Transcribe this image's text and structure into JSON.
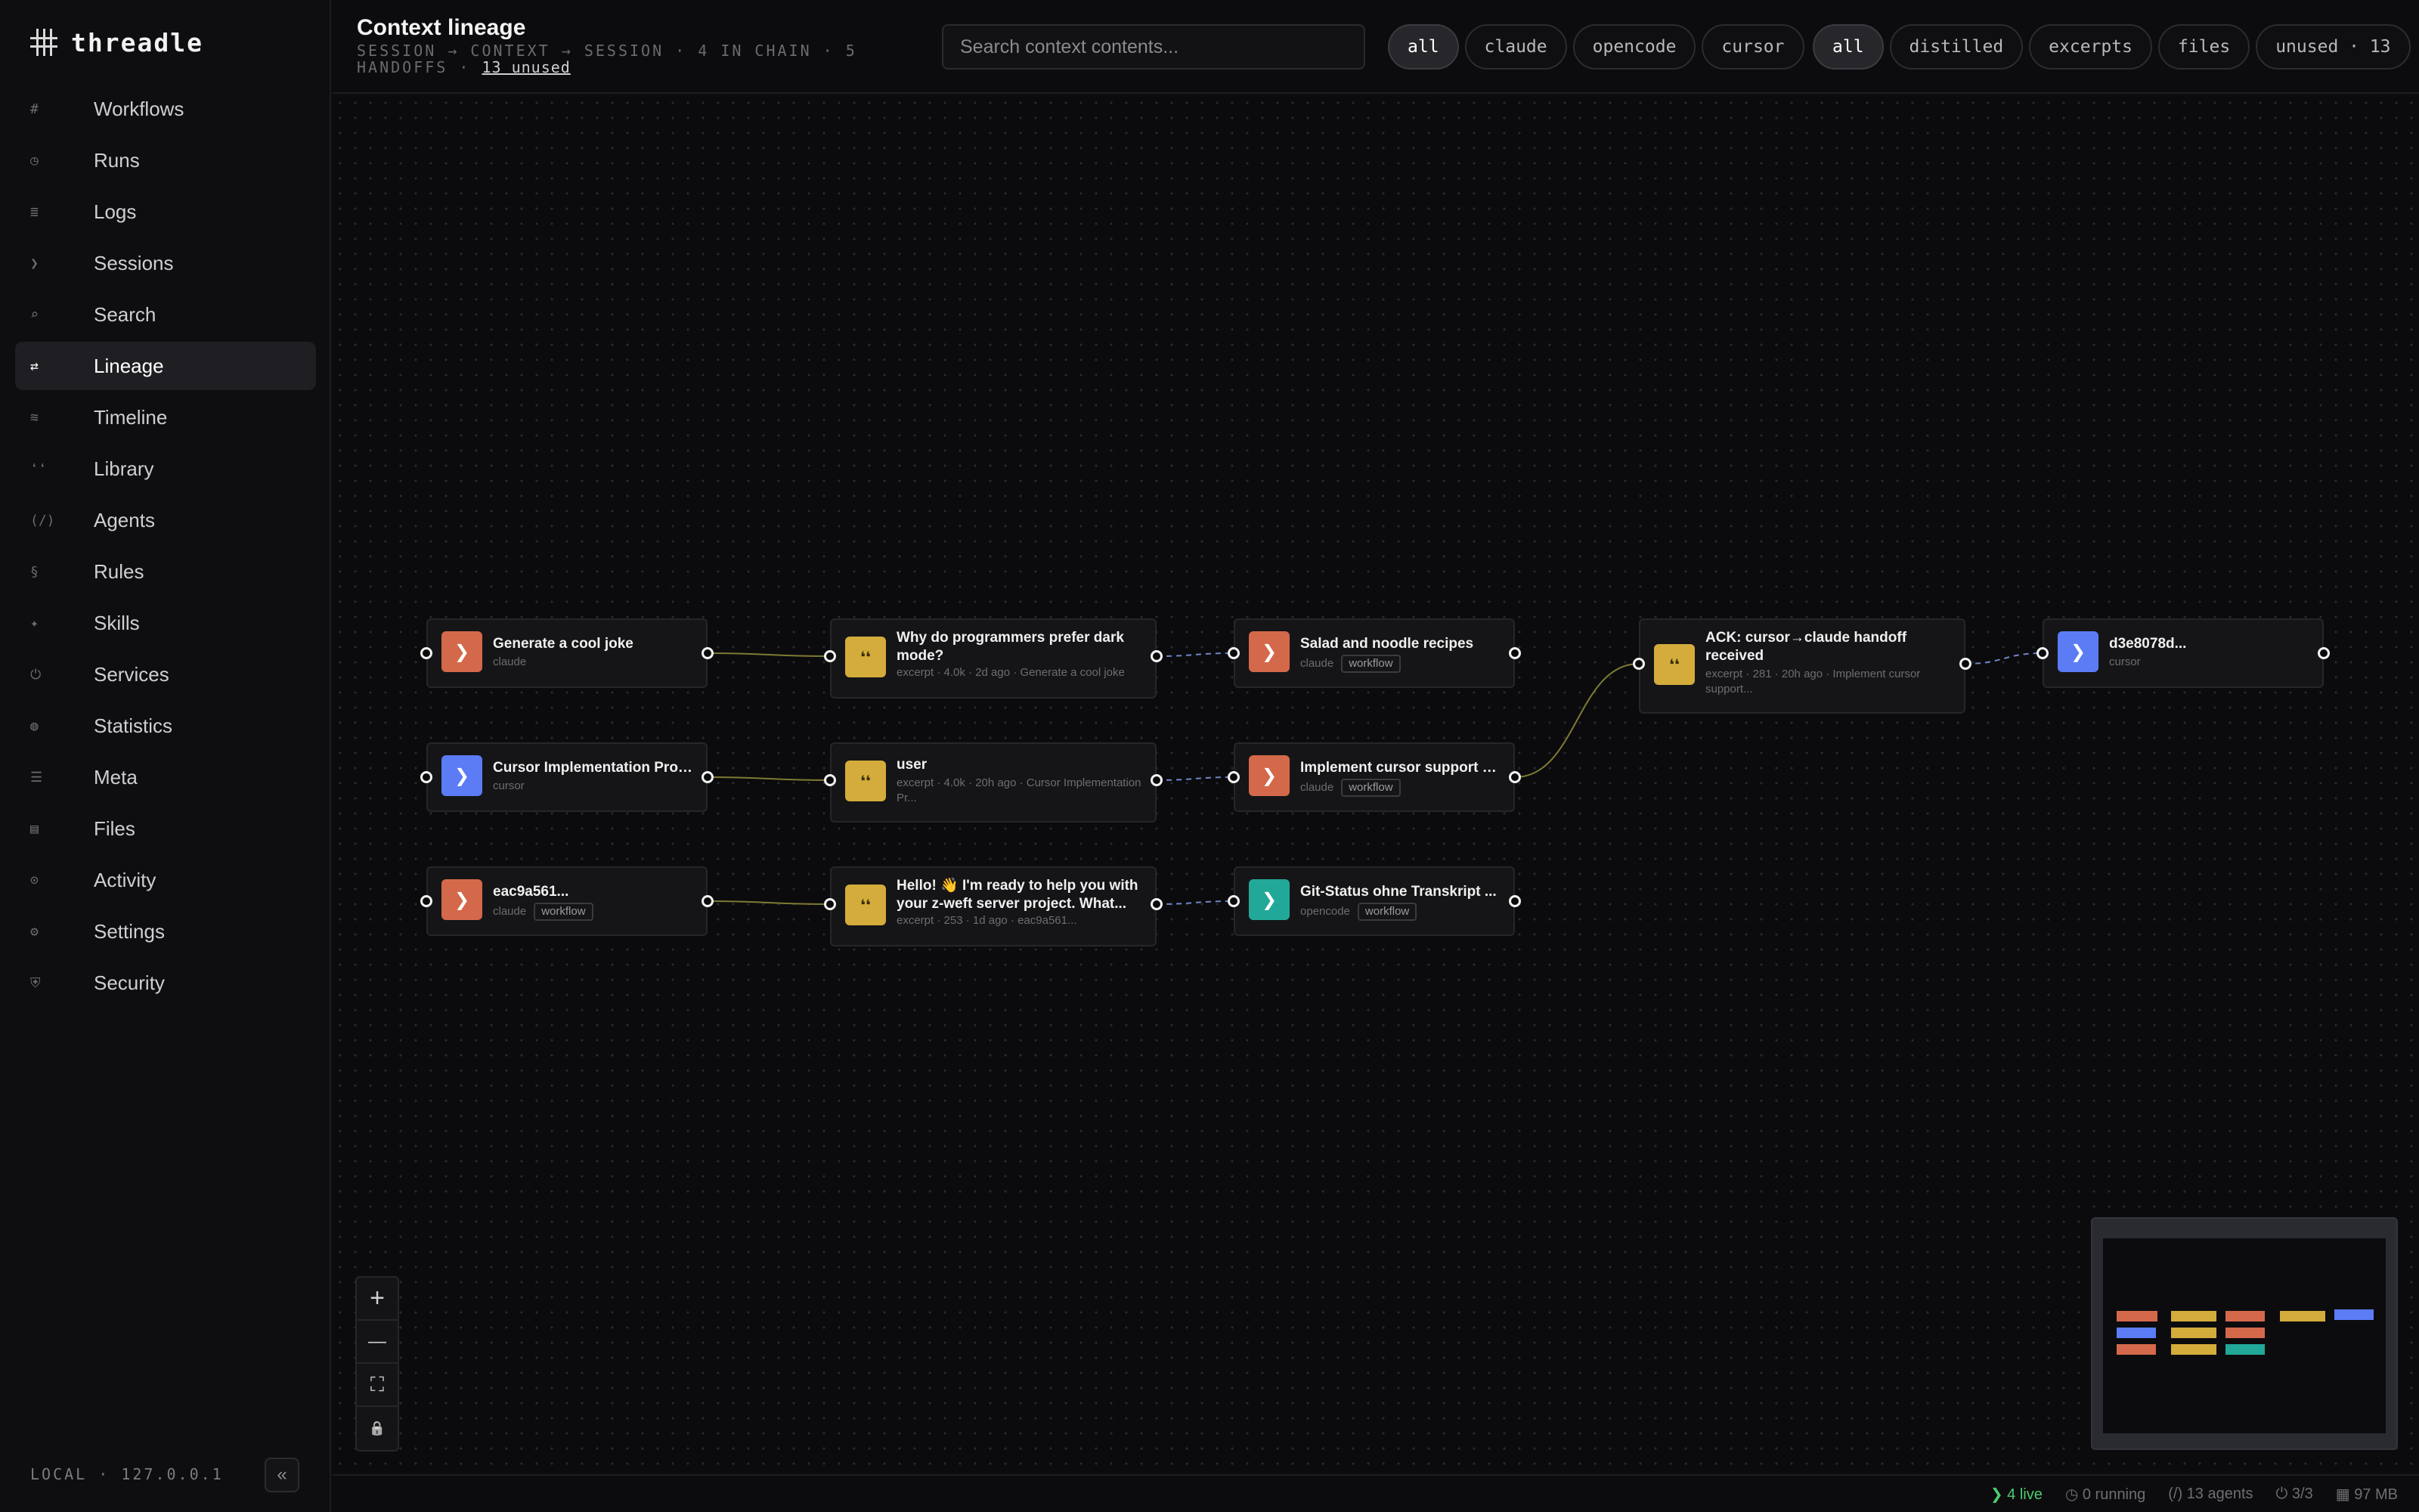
{
  "app": {
    "name": "threadle"
  },
  "sidebar": {
    "items": [
      {
        "icon": "#",
        "label": "Workflows"
      },
      {
        "icon": "◷",
        "label": "Runs"
      },
      {
        "icon": "≣",
        "label": "Logs"
      },
      {
        "icon": "❯",
        "label": "Sessions"
      },
      {
        "icon": "⌕",
        "label": "Search"
      },
      {
        "icon": "⇄",
        "label": "Lineage",
        "active": true
      },
      {
        "icon": "≋",
        "label": "Timeline"
      },
      {
        "icon": "❛❛",
        "label": "Library"
      },
      {
        "icon": "(/)",
        "label": "Agents"
      },
      {
        "icon": "§",
        "label": "Rules"
      },
      {
        "icon": "✦",
        "label": "Skills"
      },
      {
        "icon": "⏻",
        "label": "Services"
      },
      {
        "icon": "◍",
        "label": "Statistics"
      },
      {
        "icon": "☰",
        "label": "Meta"
      },
      {
        "icon": "▤",
        "label": "Files"
      },
      {
        "icon": "⊙",
        "label": "Activity"
      },
      {
        "icon": "⚙",
        "label": "Settings"
      },
      {
        "icon": "⛨",
        "label": "Security"
      }
    ],
    "host": "LOCAL · 127.0.0.1",
    "collapse_icon": "«"
  },
  "header": {
    "title": "Context lineage",
    "subtitle": "SESSION → CONTEXT → SESSION · 4 IN CHAIN · 5 HANDOFFS ·",
    "unused_link": "13 unused",
    "search_placeholder": "Search context contents...",
    "agent_filters": [
      "all",
      "claude",
      "opencode",
      "cursor"
    ],
    "type_filters": [
      "all",
      "distilled",
      "excerpts",
      "files",
      "unused · 13"
    ]
  },
  "colors": {
    "claude": "#d3694a",
    "cursor": "#5b7cf5",
    "opencode": "#22a898",
    "excerpt": "#d4ac3b"
  },
  "nodes": [
    {
      "kind": "session",
      "agent": "claude",
      "glyph": "❯",
      "title": "Generate a cool joke",
      "meta": "claude",
      "tag": ""
    },
    {
      "kind": "excerpt",
      "agent": "excerpt",
      "glyph": "❛❛",
      "title": "Why do programmers prefer dark mode?",
      "meta": "excerpt · 4.0k · 2d ago · Generate a cool joke",
      "tag": ""
    },
    {
      "kind": "session",
      "agent": "claude",
      "glyph": "❯",
      "title": "Salad and noodle recipes",
      "meta": "claude",
      "tag": "workflow"
    },
    {
      "kind": "session",
      "agent": "cursor",
      "glyph": "❯",
      "title": "Cursor Implementation Proj...",
      "meta": "cursor",
      "tag": ""
    },
    {
      "kind": "excerpt",
      "agent": "excerpt",
      "glyph": "❛❛",
      "title": "user",
      "meta": "excerpt · 4.0k · 20h ago · Cursor Implementation Pr...",
      "tag": ""
    },
    {
      "kind": "session",
      "agent": "claude",
      "glyph": "❯",
      "title": "Implement cursor support a...",
      "meta": "claude",
      "tag": "workflow"
    },
    {
      "kind": "session",
      "agent": "claude",
      "glyph": "❯",
      "title": "eac9a561...",
      "meta": "claude",
      "tag": "workflow"
    },
    {
      "kind": "excerpt",
      "agent": "excerpt",
      "glyph": "❛❛",
      "title": "Hello! 👋 I'm ready to help you with your z-weft server project. What...",
      "meta": "excerpt · 253 · 1d ago · eac9a561...",
      "tag": ""
    },
    {
      "kind": "session",
      "agent": "opencode",
      "glyph": "❯",
      "title": "Git-Status ohne Transkript ...",
      "meta": "opencode",
      "tag": "workflow"
    },
    {
      "kind": "excerpt",
      "agent": "excerpt",
      "glyph": "❛❛",
      "title": "ACK: cursor→claude handoff received",
      "meta": "excerpt · 281 · 20h ago · Implement cursor support...",
      "tag": ""
    },
    {
      "kind": "session",
      "agent": "cursor",
      "glyph": "❯",
      "title": "d3e8078d...",
      "meta": "cursor",
      "tag": ""
    }
  ],
  "zoom": {
    "in": "+",
    "out": "—",
    "fit": "⛶",
    "lock": "🔒"
  },
  "status": {
    "live": "❯ 4 live",
    "running": "◷ 0 running",
    "agents": "(/) 13 agents",
    "services": "⏻ 3/3",
    "memory": "▦ 97 MB"
  }
}
